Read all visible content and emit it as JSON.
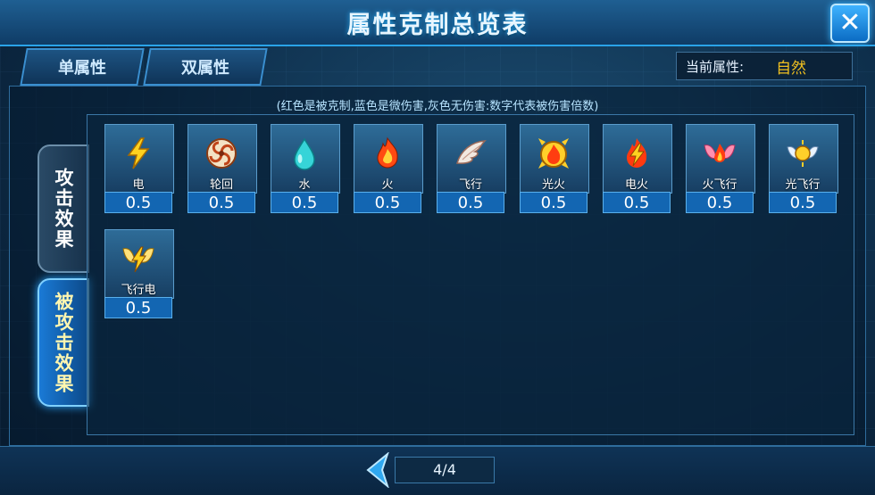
{
  "window": {
    "title": "属性克制总览表",
    "close_icon": "close-icon"
  },
  "tabs": [
    {
      "label": "单属性",
      "active": false
    },
    {
      "label": "双属性",
      "active": false
    }
  ],
  "current_attribute": {
    "label": "当前属性:",
    "value": "自然"
  },
  "hint": "(红色是被克制,蓝色是微伤害,灰色无伤害:数字代表被伤害倍数)",
  "side_tabs": [
    {
      "label": "攻击效果",
      "active": false
    },
    {
      "label": "被攻击效果",
      "active": true
    }
  ],
  "cards": [
    {
      "name": "电",
      "value": "0.5",
      "icon": "lightning-icon"
    },
    {
      "name": "轮回",
      "value": "0.5",
      "icon": "swirl-icon"
    },
    {
      "name": "水",
      "value": "0.5",
      "icon": "water-drop-icon"
    },
    {
      "name": "火",
      "value": "0.5",
      "icon": "fire-icon"
    },
    {
      "name": "飞行",
      "value": "0.5",
      "icon": "wing-icon"
    },
    {
      "name": "光火",
      "value": "0.5",
      "icon": "light-fire-icon"
    },
    {
      "name": "电火",
      "value": "0.5",
      "icon": "electric-fire-icon"
    },
    {
      "name": "火飞行",
      "value": "0.5",
      "icon": "fire-wing-icon"
    },
    {
      "name": "光飞行",
      "value": "0.5",
      "icon": "light-wing-icon"
    },
    {
      "name": "飞行电",
      "value": "0.5",
      "icon": "wing-lightning-icon"
    }
  ],
  "pagination": {
    "page": "4/4",
    "prev_icon": "prev-arrow-icon"
  },
  "colors": {
    "accent": "#2aa3e8",
    "value_bg": "#1366b2",
    "highlight": "#f0c020"
  }
}
